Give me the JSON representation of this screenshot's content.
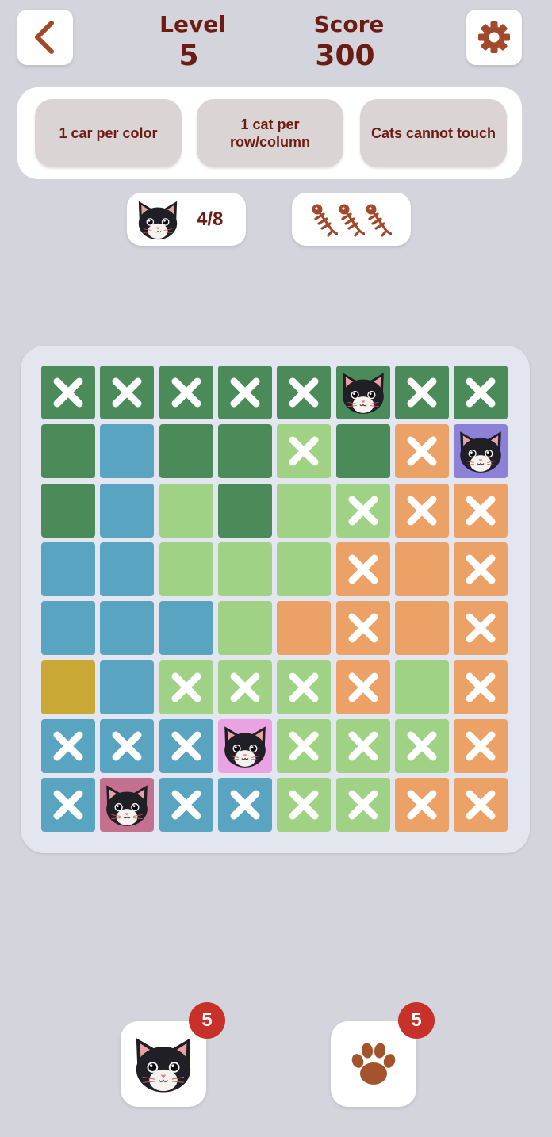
{
  "header": {
    "level_label": "Level",
    "level_value": "5",
    "score_label": "Score",
    "score_value": "300",
    "back_icon": "chevron-left-icon",
    "settings_icon": "gear-icon"
  },
  "rules": [
    "1 car per color",
    "1 cat per\nrow/column",
    "Cats cannot touch"
  ],
  "progress": {
    "cats_placed": "4/8",
    "cat_icon": "cat-face-icon",
    "lives_icon": "fish-bone-icon",
    "lives_count": 3
  },
  "colors": {
    "G": "#4b8b5a",
    "B": "#59a4c0",
    "L": "#9fd285",
    "O": "#eca167",
    "Y": "#c9a836",
    "V": "#8c80d8",
    "P": "#eaa3e2",
    "R": "#c47090",
    "accent": "#6b1d14",
    "badge": "#c8302a"
  },
  "board": {
    "regions": [
      "GGGGGGGG",
      "GBGGLGOV",
      "GBLGLLOO",
      "BBLLLOOO",
      "BBBLOOOO",
      "YBLLLOLO",
      "BBBPLLLO",
      "BRBBLLOO"
    ],
    "marks": [
      "XXXXXCXX",
      "....X.XC",
      ".....XXX",
      ".....X.X",
      ".....X.X",
      "..XXXX.X",
      "XXXCXXXX",
      "XCXXXXXX"
    ]
  },
  "tools": {
    "cat_count": "5",
    "paw_count": "5",
    "cat_icon": "cat-face-icon",
    "paw_icon": "paw-icon"
  }
}
